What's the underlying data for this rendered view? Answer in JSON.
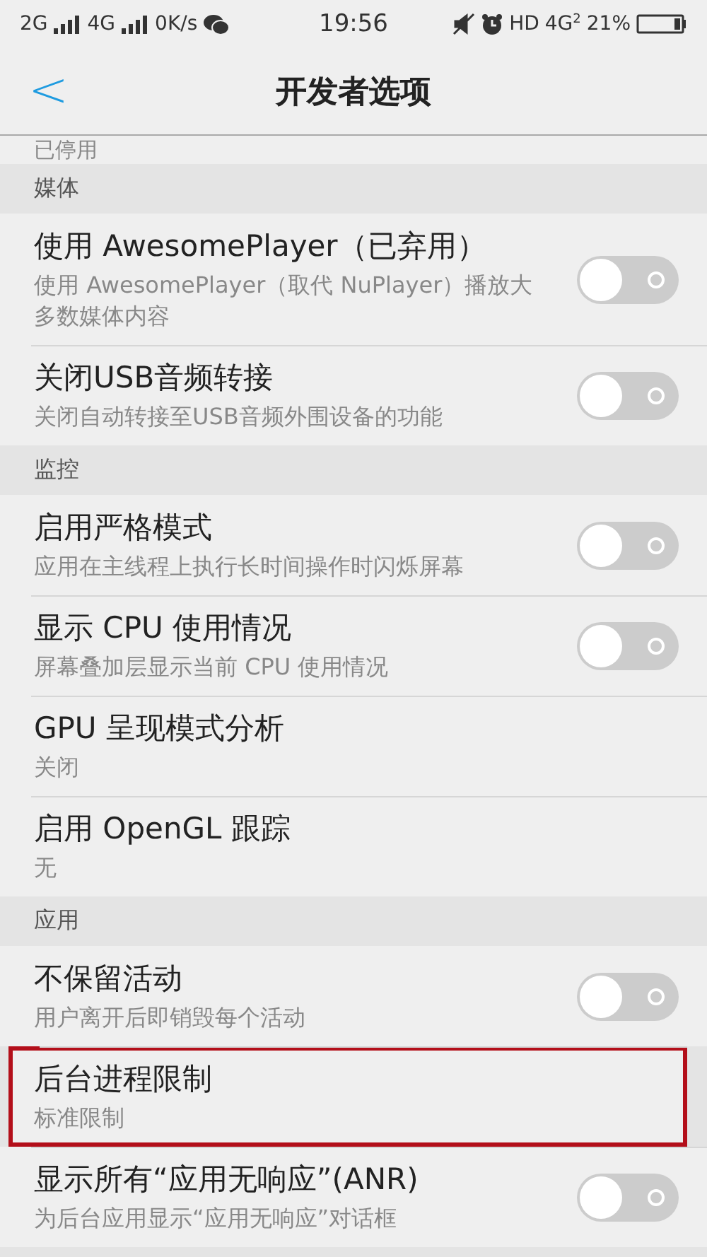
{
  "status_bar": {
    "sim1": "2G",
    "sim2": "4G",
    "speed": "0K/s",
    "time": "19:56",
    "hd": "HD",
    "network": "4G",
    "network_sub": "2",
    "battery": "21%"
  },
  "header": {
    "back": "<",
    "title": "开发者选项"
  },
  "partial_text": "已停用",
  "sections": [
    {
      "title": "媒体",
      "items": [
        {
          "kind": "toggle",
          "title": "使用 AwesomePlayer（已弃用）",
          "summary": "使用 AwesomePlayer（取代 NuPlayer）播放大多数媒体内容",
          "on": false,
          "highlighted": false
        },
        {
          "kind": "toggle",
          "title": "关闭USB音频转接",
          "summary": "关闭自动转接至USB音频外围设备的功能",
          "on": false,
          "highlighted": false
        }
      ]
    },
    {
      "title": "监控",
      "items": [
        {
          "kind": "toggle",
          "title": "启用严格模式",
          "summary": "应用在主线程上执行长时间操作时闪烁屏幕",
          "on": false,
          "highlighted": false
        },
        {
          "kind": "toggle",
          "title": "显示 CPU 使用情况",
          "summary": "屏幕叠加层显示当前 CPU 使用情况",
          "on": false,
          "highlighted": false
        },
        {
          "kind": "value",
          "title": "GPU 呈现模式分析",
          "summary": "关闭",
          "highlighted": false
        },
        {
          "kind": "value",
          "title": "启用 OpenGL 跟踪",
          "summary": "无",
          "highlighted": false
        }
      ]
    },
    {
      "title": "应用",
      "items": [
        {
          "kind": "toggle",
          "title": "不保留活动",
          "summary": "用户离开后即销毁每个活动",
          "on": false,
          "highlighted": false
        },
        {
          "kind": "value",
          "title": "后台进程限制",
          "summary": "标准限制",
          "highlighted": true
        },
        {
          "kind": "toggle",
          "title": "显示所有“应用无响应”(ANR)",
          "summary": "为后台应用显示“应用无响应”对话框",
          "on": false,
          "highlighted": false
        }
      ]
    }
  ]
}
